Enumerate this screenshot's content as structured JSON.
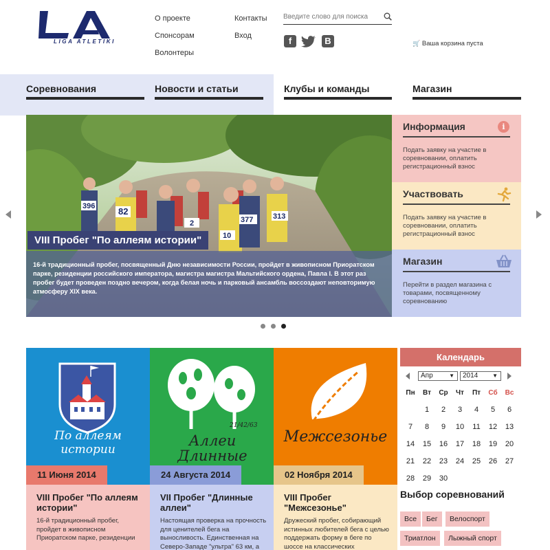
{
  "header": {
    "logo_text": "LIGA ATLETIKI",
    "links_col1": [
      "О проекте",
      "Спонсорам",
      "Волонтеры"
    ],
    "links_col2": [
      "Контакты",
      "Вход"
    ],
    "search": {
      "placeholder": "Введите слово для поиска"
    },
    "social": [
      "facebook-icon",
      "twitter-icon",
      "vkontakte-icon"
    ],
    "social_letters": {
      "facebook": "f",
      "vk": "B"
    },
    "cart_text": "Ваша корзина пуста"
  },
  "nav": [
    "Соревнования",
    "Новости и статьи",
    "Клубы и команды",
    "Магазин"
  ],
  "hero": {
    "title": "VIII Пробег \"По аллеям истории\"",
    "description": "16-й традиционный пробег, посвященный Дню независимости России, пройдет в живописном Приоратском парке, резиденции российского императора, магистра магистра Мальтийского ордена, Павла I. В этот раз пробег будет проведен поздно вечером, когда белая ночь и парковый ансамбль воссоздают неповторимую атмосферу XIX века.",
    "bibs": [
      "396",
      "82",
      "2",
      "10",
      "377",
      "313"
    ],
    "active_slide": 3,
    "slides": 3
  },
  "sidebar": [
    {
      "title": "Информация",
      "text": "Подать заявку на участие в соревновании, оплатить регистрационный взнос",
      "icon": "info-icon",
      "color": "#f5c6c3"
    },
    {
      "title": "Участвовать",
      "text": "Подать заявку на участие в соревновании, оплатить регистрационный взнос",
      "icon": "runner-icon",
      "color": "#fbe8c4"
    },
    {
      "title": "Магазин",
      "text": "Перейти в раздел магазина с товарами, посвященному соревнованию",
      "icon": "basket-icon",
      "color": "#c7cff1"
    }
  ],
  "cards": [
    {
      "art_text": "По аллеям истории",
      "date": "11 Июня 2014",
      "title": "VIII Пробег \"По аллеям истории\"",
      "text": "16-й традиционный пробег, пройдет в живописном Приоратском парке, резиденции",
      "color": "#1a8fd0",
      "date_color": "#e8796c",
      "body_color": "#f6c4c1"
    },
    {
      "art_text": "Аллеи Длинные",
      "art_sub": "21/42/63",
      "date": "24 Августа 2014",
      "title": "VII Пробег \"Длинные аллеи\"",
      "text": "Настоящая проверка на прочность для ценителей бега на выносливость. Единственная на Северо-Западе \"ультра\" 63 км, а",
      "color": "#2aa84a",
      "date_color": "#8a9cd8",
      "body_color": "#c7cff1"
    },
    {
      "art_text": "Межсезонье",
      "date": "02 Ноября 2014",
      "title": "VIII Пробег \"Межсезонье\"",
      "text": "Дружеский пробег, собирающий истинных любителей бега с целью поддержать форму в беге по шоссе на классических",
      "color": "#ef7d00",
      "date_color": "#e6c58a",
      "body_color": "#fbe8c4"
    }
  ],
  "calendar": {
    "title": "Календарь",
    "month": "Апр",
    "year": "2014",
    "weekdays": [
      "Пн",
      "Вт",
      "Ср",
      "Чт",
      "Пт",
      "Сб",
      "Вс"
    ],
    "weeks": [
      [
        "",
        "1",
        "2",
        "3",
        "4",
        "5",
        "6"
      ],
      [
        "7",
        "8",
        "9",
        "10",
        "11",
        "12",
        "13"
      ],
      [
        "14",
        "15",
        "16",
        "17",
        "18",
        "19",
        "20"
      ],
      [
        "21",
        "22",
        "23",
        "24",
        "25",
        "26",
        "27"
      ],
      [
        "28",
        "29",
        "30",
        "",
        "",
        "",
        ""
      ]
    ]
  },
  "filter": {
    "title": "Выбор соревнований",
    "tags_row1": [
      "Все",
      "Бег",
      "Велоспорт"
    ],
    "tags_row2": [
      "Триатлон",
      "Лыжный спорт"
    ]
  }
}
